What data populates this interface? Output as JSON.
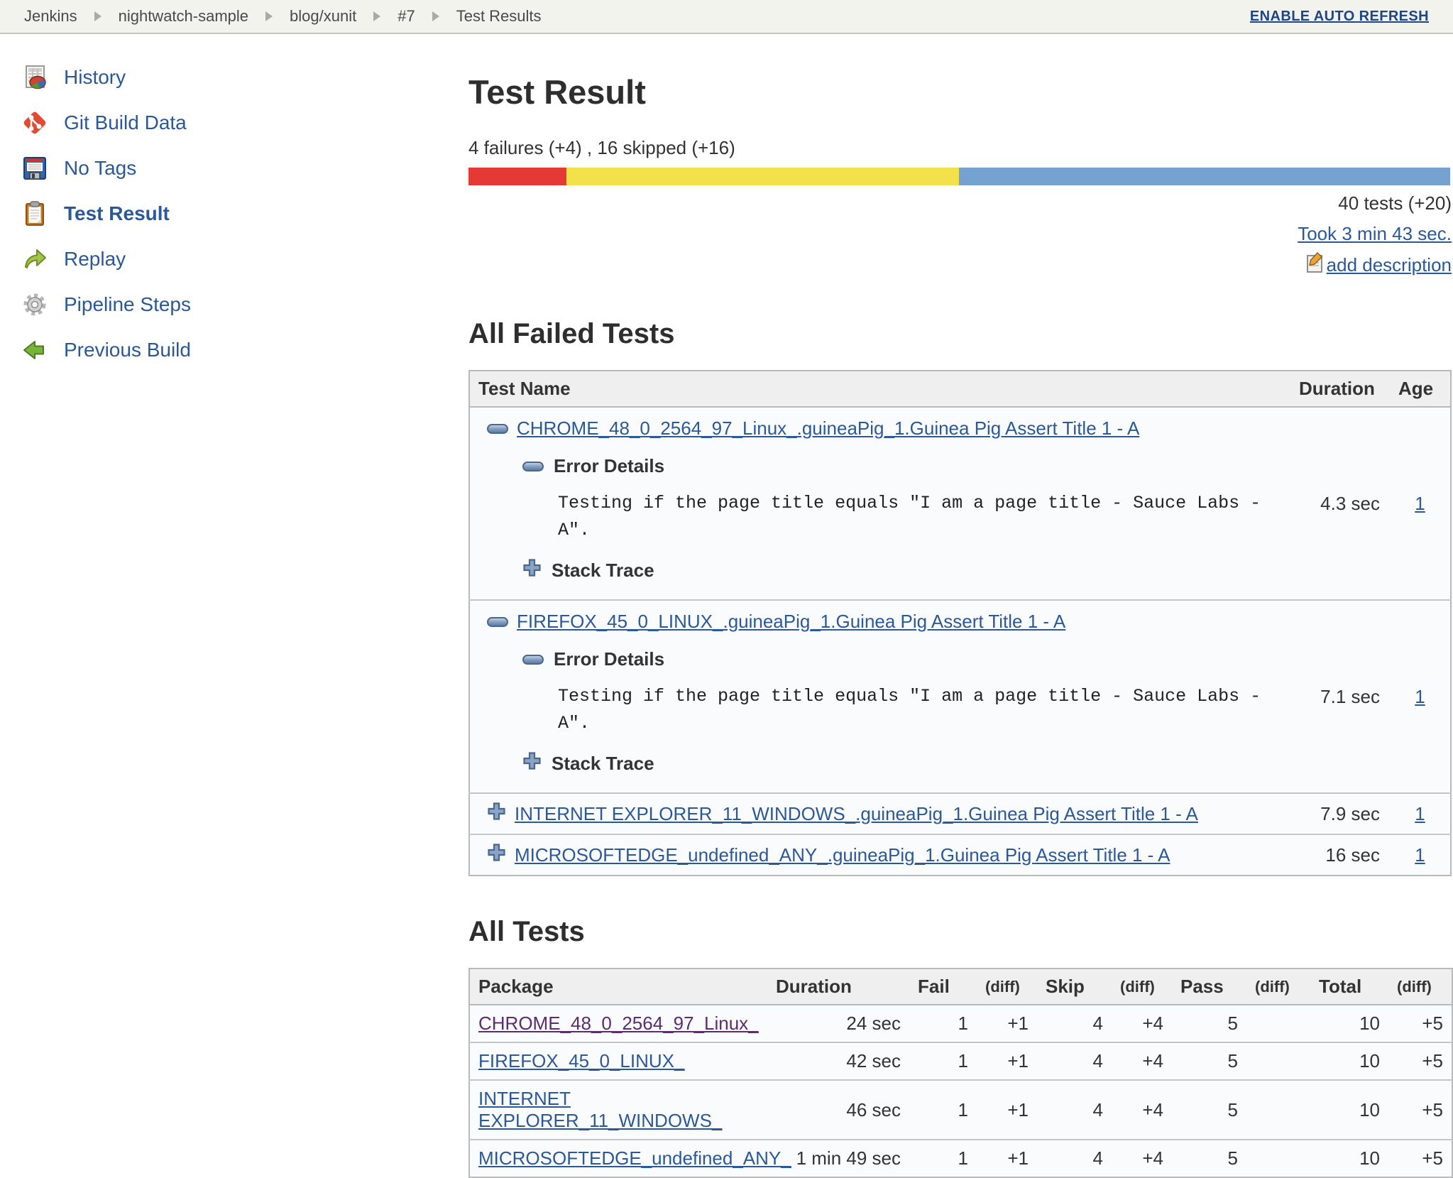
{
  "breadcrumb": {
    "items": [
      "Jenkins",
      "nightwatch-sample",
      "blog/xunit",
      "#7",
      "Test Results"
    ],
    "auto_refresh_label": "ENABLE AUTO REFRESH"
  },
  "sidebar": {
    "items": [
      {
        "label": "History",
        "icon": "history-icon"
      },
      {
        "label": "Git Build Data",
        "icon": "git-icon"
      },
      {
        "label": "No Tags",
        "icon": "floppy-disk-icon"
      },
      {
        "label": "Test Result",
        "icon": "clipboard-icon",
        "active": true
      },
      {
        "label": "Replay",
        "icon": "replay-arrow-icon"
      },
      {
        "label": "Pipeline Steps",
        "icon": "gear-icon"
      },
      {
        "label": "Previous Build",
        "icon": "previous-build-arrow-icon"
      }
    ]
  },
  "header": {
    "title": "Test Result",
    "failure_summary": "4 failures (+4) , 16 skipped (+16)",
    "tests_count": "40 tests (+20)",
    "took_label": "Took 3 min 43 sec.",
    "add_description_label": "add description"
  },
  "progress_bar": {
    "failed_pct": 10,
    "skipped_pct": 40,
    "passed_pct": 50,
    "failed_color": "#e53935",
    "skipped_color": "#f3e14c",
    "passed_color": "#75a1d0"
  },
  "colors": {
    "link": "#2a5899",
    "visited_link": "#5b2c6f",
    "breadcrumb_bg": "#f1f3ec",
    "table_header_bg": "#efefef"
  },
  "failed_tests": {
    "heading": "All Failed Tests",
    "columns": {
      "name": "Test Name",
      "duration": "Duration",
      "age": "Age"
    },
    "error_details_label": "Error Details",
    "stack_trace_label": "Stack Trace",
    "rows": [
      {
        "name": "CHROME_48_0_2564_97_Linux_.guineaPig_1.Guinea Pig Assert Title 1 - A",
        "state": "expanded",
        "error_text": "Testing if the page title equals \"I am a page title - Sauce Labs - A\".",
        "duration": "4.3 sec",
        "age": "1"
      },
      {
        "name": "FIREFOX_45_0_LINUX_.guineaPig_1.Guinea Pig Assert Title 1 - A",
        "state": "expanded",
        "error_text": "Testing if the page title equals \"I am a page title - Sauce Labs - A\".",
        "duration": "7.1 sec",
        "age": "1"
      },
      {
        "name": "INTERNET EXPLORER_11_WINDOWS_.guineaPig_1.Guinea Pig Assert Title 1 - A",
        "state": "collapsed",
        "duration": "7.9 sec",
        "age": "1"
      },
      {
        "name": "MICROSOFTEDGE_undefined_ANY_.guineaPig_1.Guinea Pig Assert Title 1 - A",
        "state": "collapsed",
        "duration": "16 sec",
        "age": "1"
      }
    ]
  },
  "all_tests": {
    "heading": "All Tests",
    "columns": [
      "Package",
      "Duration",
      "Fail",
      "(diff)",
      "Skip",
      "(diff)",
      "Pass",
      "(diff)",
      "Total",
      "(diff)"
    ],
    "rows": [
      {
        "package": "CHROME_48_0_2564_97_Linux_",
        "duration": "24 sec",
        "fail": "1",
        "fail_diff": "+1",
        "skip": "4",
        "skip_diff": "+4",
        "pass": "5",
        "pass_diff": "",
        "total": "10",
        "total_diff": "+5",
        "visited": true
      },
      {
        "package": "FIREFOX_45_0_LINUX_",
        "duration": "42 sec",
        "fail": "1",
        "fail_diff": "+1",
        "skip": "4",
        "skip_diff": "+4",
        "pass": "5",
        "pass_diff": "",
        "total": "10",
        "total_diff": "+5",
        "visited": false
      },
      {
        "package": "INTERNET EXPLORER_11_WINDOWS_",
        "duration": "46 sec",
        "fail": "1",
        "fail_diff": "+1",
        "skip": "4",
        "skip_diff": "+4",
        "pass": "5",
        "pass_diff": "",
        "total": "10",
        "total_diff": "+5",
        "visited": false
      },
      {
        "package": "MICROSOFTEDGE_undefined_ANY_",
        "duration": "1 min 49 sec",
        "fail": "1",
        "fail_diff": "+1",
        "skip": "4",
        "skip_diff": "+4",
        "pass": "5",
        "pass_diff": "",
        "total": "10",
        "total_diff": "+5",
        "visited": false
      }
    ]
  }
}
